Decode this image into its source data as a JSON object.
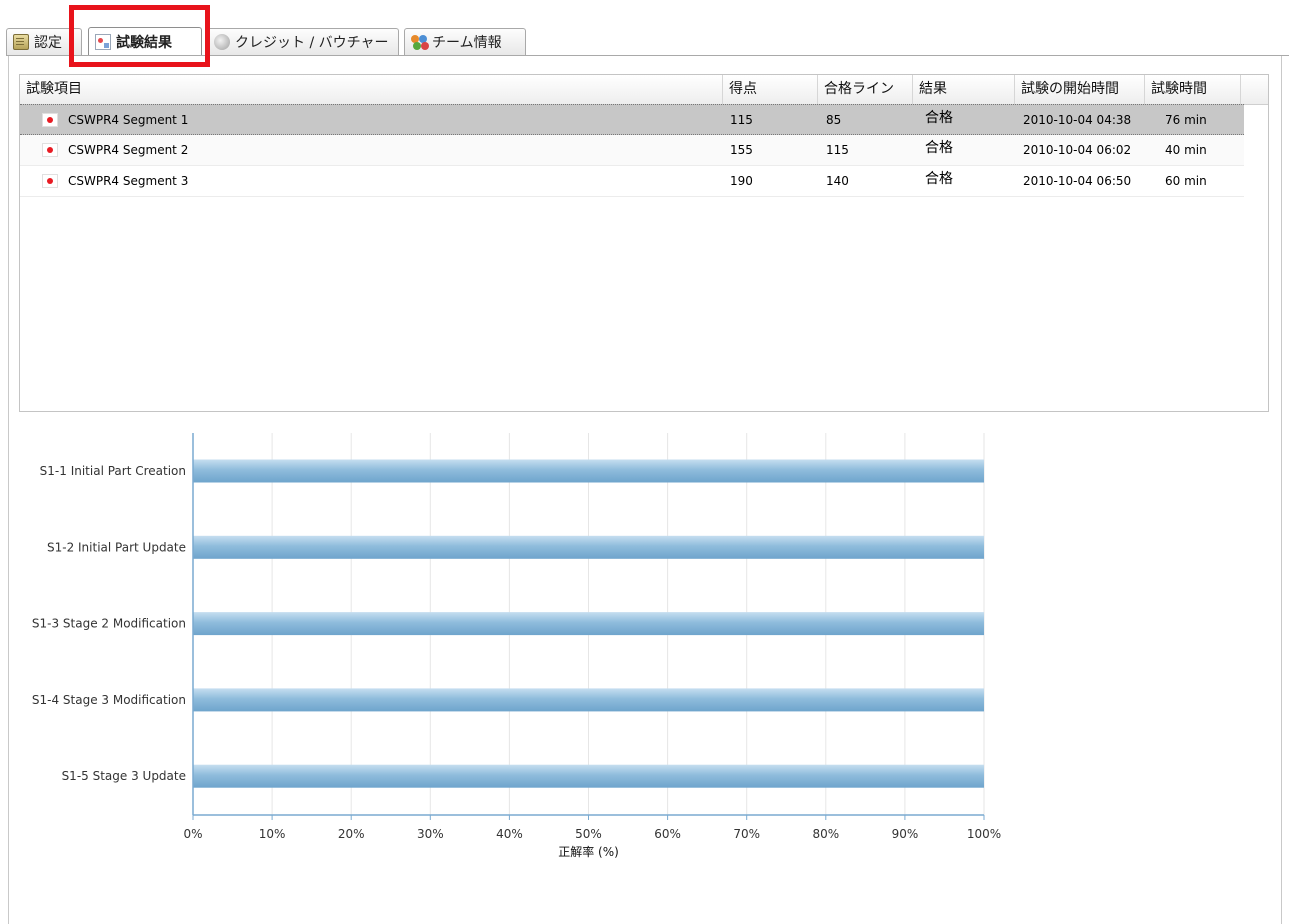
{
  "tabs": [
    {
      "label": "認定",
      "icon": "certificate-icon",
      "active": false
    },
    {
      "label": "試験結果",
      "icon": "exam-results-icon",
      "active": true
    },
    {
      "label": "クレジット / バウチャー",
      "icon": "credit-icon",
      "active": false
    },
    {
      "label": "チーム情報",
      "icon": "team-icon",
      "active": false
    }
  ],
  "grid": {
    "columns": [
      "試験項目",
      "得点",
      "合格ライン",
      "結果",
      "試験の開始時間",
      "試験時間"
    ],
    "rows": [
      {
        "name": "CSWPR4 Segment 1",
        "score": "115",
        "pass_line": "85",
        "result": "合格",
        "start": "2010-10-04 04:38",
        "duration": "76 min"
      },
      {
        "name": "CSWPR4 Segment 2",
        "score": "155",
        "pass_line": "115",
        "result": "合格",
        "start": "2010-10-04 06:02",
        "duration": "40 min"
      },
      {
        "name": "CSWPR4 Segment 3",
        "score": "190",
        "pass_line": "140",
        "result": "合格",
        "start": "2010-10-04 06:50",
        "duration": "60 min"
      }
    ],
    "selected_row": 0
  },
  "chart_data": {
    "type": "bar",
    "orientation": "horizontal",
    "categories": [
      "S1-1 Initial Part Creation",
      "S1-2 Initial Part Update",
      "S1-3 Stage 2 Modification",
      "S1-4 Stage 3 Modification",
      "S1-5 Stage 3 Update"
    ],
    "values": [
      100,
      100,
      100,
      100,
      100
    ],
    "xlim": [
      0,
      100
    ],
    "xticks": [
      "0%",
      "10%",
      "20%",
      "30%",
      "40%",
      "50%",
      "60%",
      "70%",
      "80%",
      "90%",
      "100%"
    ],
    "xlabel": "正解率 (%)",
    "grid": true,
    "bar_color": "#8fbcdc"
  }
}
